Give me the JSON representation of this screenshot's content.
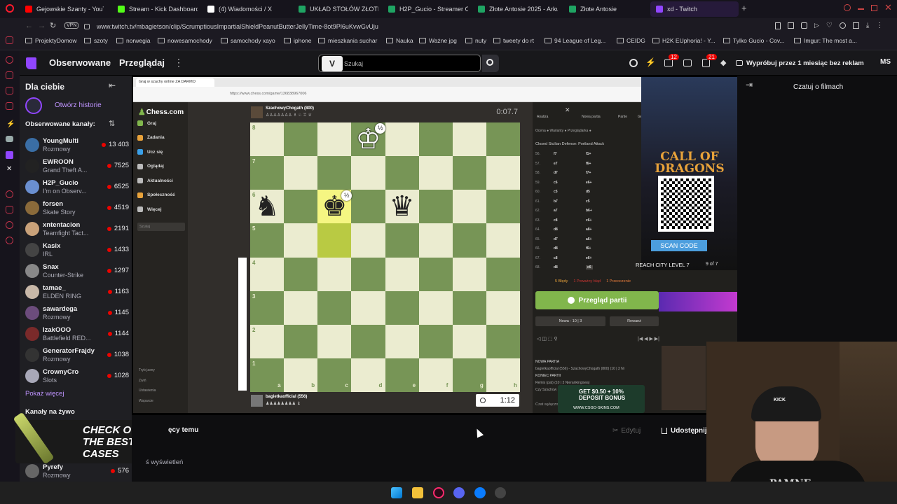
{
  "tabs": [
    {
      "label": "Gejowskie Szanty - YouTu",
      "color": "#ff0000"
    },
    {
      "label": "Stream - Kick Dashboard",
      "color": "#53fc18"
    },
    {
      "label": "(4) Wiadomości / X",
      "color": "#ffffff"
    },
    {
      "label": "UKŁAD STOŁÓW ZŁOTE",
      "color": "#1fa463"
    },
    {
      "label": "H2P_Gucio - Streamer O",
      "color": "#1fa463"
    },
    {
      "label": "Złote Antosie 2025 - Arku",
      "color": "#1fa463"
    },
    {
      "label": "Złote Antosie",
      "color": "#1fa463"
    },
    {
      "label": "xd - Twitch",
      "color": "#9146ff"
    }
  ],
  "address": {
    "url": "www.twitch.tv/mbagietson/clip/ScrumptiousImpartialShieldPeanutButterJellyTime-8ot9Pl6uKvwGvUju",
    "vpn": "VPN"
  },
  "bookmarks": [
    "ProjektyDomow",
    "szoty",
    "norwegia",
    "nowesamochody",
    "samochody xayo",
    "iphone",
    "mieszkania suchar",
    "Nauka",
    "Ważne jpg",
    "nuty",
    "tweety do rt",
    "94 League of Leg...",
    "CEIDG",
    "H2K EUphoria! - Y...",
    "Tylko Gucio - Cov...",
    "Imgur: The most a..."
  ],
  "twitch": {
    "nav_following": "Obserwowane",
    "nav_browse": "Przeglądaj",
    "search_placeholder": "Szukaj",
    "badge_notif": "12",
    "badge_msgs": "21",
    "promo": "Wypróbuj przez 1 miesiąc bez reklam",
    "user": "MS",
    "for_you": "Dla ciebie",
    "open_stories": "Otwórz historie",
    "followed_channels": "Obserwowane kanały:",
    "show_more": "Pokaż więcej",
    "live_channels": "Kanały na żywo",
    "channels": [
      {
        "name": "YoungMulti",
        "game": "Rozmowy",
        "viewers": "13 403",
        "color": "#3a6ea5"
      },
      {
        "name": "EWROON",
        "game": "Grand Theft A...",
        "viewers": "7525",
        "color": "#222"
      },
      {
        "name": "H2P_Gucio",
        "game": "I'm on Observ...",
        "viewers": "6525",
        "color": "#6a8fd0"
      },
      {
        "name": "forsen",
        "game": "Skate Story",
        "viewers": "4519",
        "color": "#8a6a3a"
      },
      {
        "name": "xntentacion",
        "game": "Teamfight Tact...",
        "viewers": "2191",
        "color": "#c9a27a"
      },
      {
        "name": "Kasix",
        "game": "IRL",
        "viewers": "1433",
        "color": "#444"
      },
      {
        "name": "Snax",
        "game": "Counter-Strike",
        "viewers": "1297",
        "color": "#888"
      },
      {
        "name": "tamae_",
        "game": "ELDEN RING",
        "viewers": "1163",
        "color": "#c8b8a8"
      },
      {
        "name": "sawardega",
        "game": "Rozmowy",
        "viewers": "1145",
        "color": "#6c4c7c"
      },
      {
        "name": "IzakOOO",
        "game": "Battlefield RED...",
        "viewers": "1144",
        "color": "#7a2a2a"
      },
      {
        "name": "GeneratorFrajdy",
        "game": "Rozmowy",
        "viewers": "1038",
        "color": "#333"
      },
      {
        "name": "CrownyCro",
        "game": "Slots",
        "viewers": "1028",
        "color": "#a8a8b8"
      }
    ],
    "bottom_channel": {
      "name": "Pyrefy",
      "game": "Rozmowy",
      "viewers": "576"
    },
    "chat_label": "Czatuj o filmach",
    "ago": "ęcy temu",
    "views": "ś wyświetleń",
    "edit": "Edytuj",
    "share": "Udostępnij"
  },
  "chess": {
    "site_tab": "Graj w szachy online ZA DARMO",
    "url": "https://www.chess.com/game/136838967006",
    "logo": "Chess.com",
    "menu": [
      "Graj",
      "Zadania",
      "Ucz się",
      "Oglądaj",
      "Aktualności",
      "Społeczność",
      "Więcej"
    ],
    "search": "Szukaj",
    "footer": [
      "Tryb jasny",
      "Zwiń",
      "Ustawienia",
      "Wsparcie"
    ],
    "top_player": "SzachowyChogath (800)",
    "top_clock": "0:07.7",
    "bottom_player": "bagietkaofficial (556)",
    "bottom_clock": "1:12",
    "ranks": [
      "8",
      "7",
      "6",
      "5",
      "4",
      "3",
      "2",
      "1"
    ],
    "files": [
      "a",
      "b",
      "c",
      "d",
      "e",
      "f",
      "g",
      "h"
    ],
    "half": "½",
    "panel_tabs": [
      "Analiza",
      "Nowa partia",
      "Partie",
      "Gracze"
    ],
    "opening": "Closed Sicilian Defense: Portland Attack",
    "move_numbers": [
      "56.",
      "57.",
      "58.",
      "59.",
      "60.",
      "61.",
      "62.",
      "63.",
      "64.",
      "65.",
      "66.",
      "67.",
      "68."
    ],
    "moves_w": [
      "f7",
      "e7",
      "d7",
      "c6",
      "c5",
      "b7",
      "a7",
      "c8",
      "d8",
      "d7",
      "d8",
      "c8",
      "d8"
    ],
    "moves_b": [
      "f1+",
      "f6+",
      "f7+",
      "e6+",
      "d5",
      "c5",
      "b6+",
      "c6+",
      "a8+",
      "a6+",
      "f6+",
      "e6+",
      "c6"
    ],
    "stats": [
      "5 Błędy",
      "1 Poważny błąd",
      "1 Przeoczenie"
    ],
    "review": "Przegląd partii",
    "new_game": "Nowa - 10 | 3",
    "rematch": "Rewanż",
    "log": [
      "NOWA PARTIA",
      "bagietkaofficial (556) - SzachowyChogath (800) (10 | 3 Ni",
      "KONIEC PARTII",
      "Remis (pat) (10 | 3 Nierankingowa)",
      "Czy Szachow"
    ],
    "chat_off": "Czat wyłączony"
  },
  "ads": {
    "cod_title": "CALL OF DRAGONS",
    "scan": "SCAN CODE",
    "reach": "REACH CITY LEVEL 7",
    "count": "9 of 7",
    "csgo": "GET $0.50 + 10% DEPOSIT BONUS",
    "csgo_url": "WWW.CSGO-SKINS.COM",
    "cases": "CHECK OUT THE BEST CASES"
  },
  "webcam": {
    "cap": "KICK",
    "shirt": "PAMNE"
  }
}
